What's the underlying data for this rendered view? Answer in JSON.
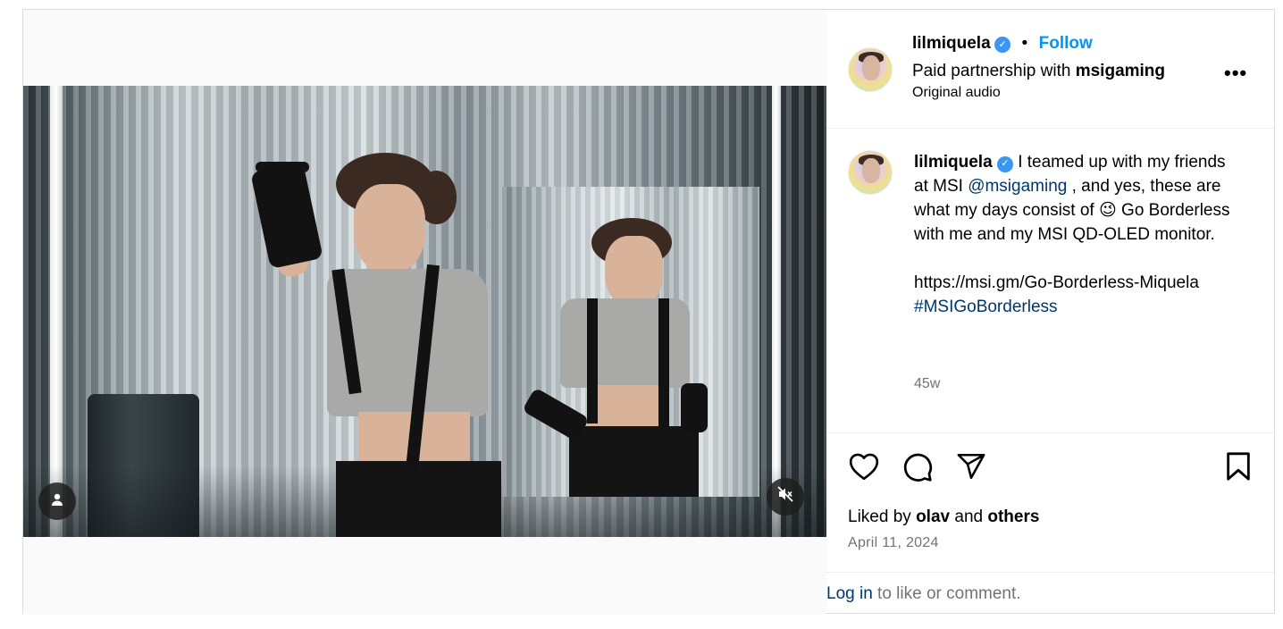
{
  "post": {
    "username": "lilmiquela",
    "follow_label": "Follow",
    "partnership_prefix": "Paid partnership with",
    "partner": "msigaming",
    "audio": "Original audio",
    "more_label": "•••",
    "caption": {
      "username": "lilmiquela",
      "line1": " I teamed up with my friends at MSI ",
      "mention": "@msigaming",
      "line2": " , and yes, these are what my days consist of 😉 Go Borderless with me and my MSI QD-OLED monitor.",
      "url": "https://msi.gm/Go-Borderless-Miquela",
      "hashtag": "#MSIGoBorderless"
    },
    "time_ago": "45w",
    "liked_by_prefix": "Liked by",
    "liked_by_user": "olav",
    "liked_by_and": "and",
    "liked_by_others": "others",
    "date": "April 11, 2024",
    "footer": {
      "login": "Log in",
      "rest": " to like or comment."
    }
  },
  "icons": {
    "user": "user-icon",
    "mute": "muted-speaker-icon",
    "like": "heart-icon",
    "comment": "comment-icon",
    "share": "share-paper-plane-icon",
    "save": "bookmark-icon",
    "verified": "verified-badge-icon"
  },
  "colors": {
    "follow": "#0095f6",
    "verified": "#3897f0",
    "link": "#00376b",
    "secondary": "#737373"
  }
}
